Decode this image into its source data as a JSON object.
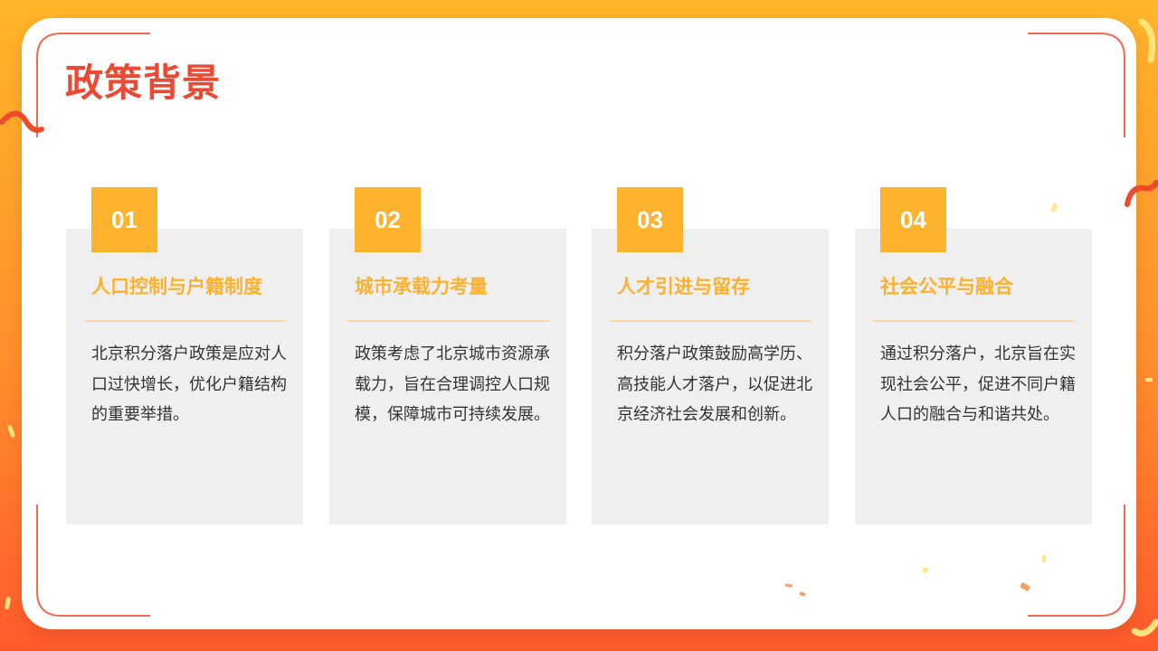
{
  "page": {
    "title": "政策背景"
  },
  "theme": {
    "accent": "#fdb32d",
    "title_color": "#ea4a33",
    "card_bg": "#efefef",
    "background_top": "#ffb52a",
    "background_bottom": "#ff5a2c"
  },
  "cards": [
    {
      "number": "01",
      "title": "人口控制与户籍制度",
      "body": "北京积分落户政策是应对人口过快增长，优化户籍结构的重要举措。"
    },
    {
      "number": "02",
      "title": "城市承载力考量",
      "body": "政策考虑了北京城市资源承载力，旨在合理调控人口规模，保障城市可持续发展。"
    },
    {
      "number": "03",
      "title": "人才引进与留存",
      "body": "积分落户政策鼓励高学历、高技能人才落户，以促进北京经济社会发展和创新。"
    },
    {
      "number": "04",
      "title": "社会公平与融合",
      "body": "通过积分落户，北京旨在实现社会公平，促进不同户籍人口的融合与和谐共处。"
    }
  ]
}
